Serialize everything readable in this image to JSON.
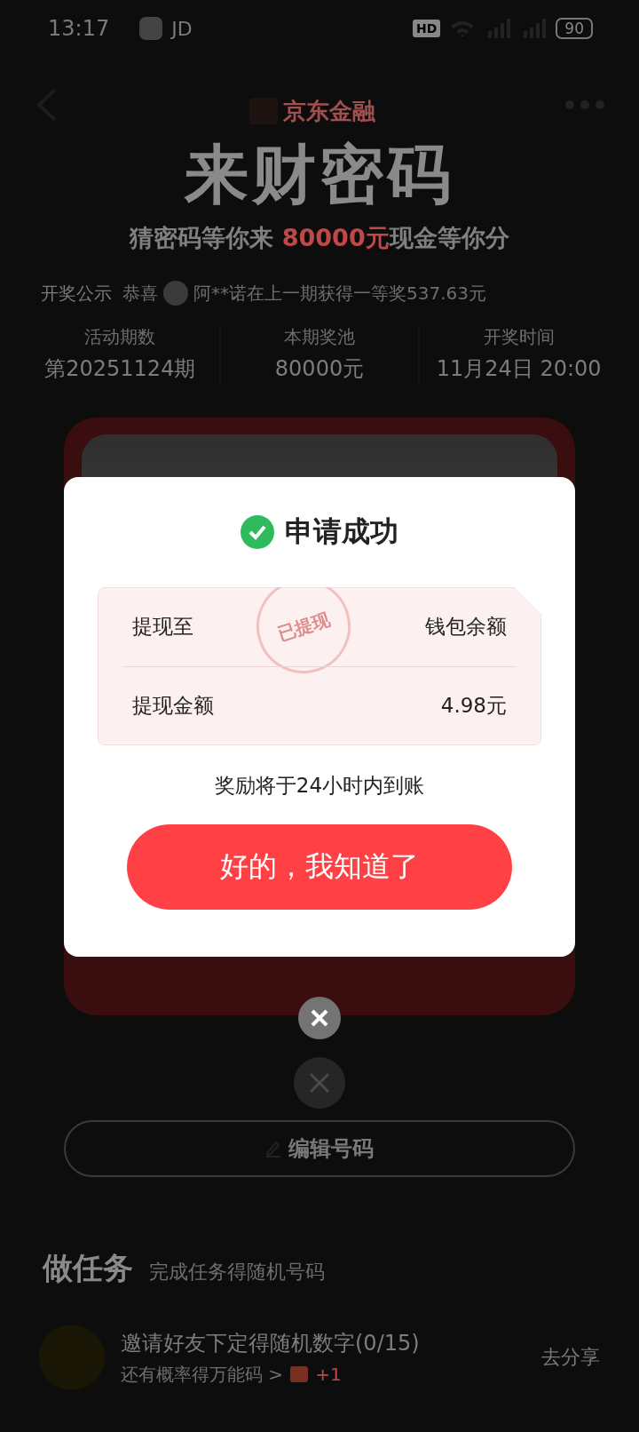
{
  "status_bar": {
    "time": "13:17",
    "app_badge": "JD",
    "hd_badge": "HD",
    "battery": "90"
  },
  "header": {
    "brand": "京东金融",
    "title": "来财密码",
    "subtitle": [
      {
        "text": "猜密码等你来 ",
        "highlight": false
      },
      {
        "text": "80000元",
        "highlight": true
      },
      {
        "text": "现金等你分",
        "highlight": false
      }
    ]
  },
  "announcement": {
    "label": "开奖公示",
    "message_before": "恭喜",
    "message_after": "阿**诺在上一期获得一等奖537.63元"
  },
  "stats": [
    {
      "label": "活动期数",
      "value": "第20251124期"
    },
    {
      "label": "本期奖池",
      "value": "80000元"
    },
    {
      "label": "开奖时间",
      "value": "11月24日 20:00"
    }
  ],
  "dialog": {
    "title": "申请成功",
    "stamp": "已提现",
    "rows": [
      {
        "label": "提现至",
        "value": "钱包余额"
      },
      {
        "label": "提现金额",
        "value": "4.98元"
      }
    ],
    "note": "奖励将于24小时内到账",
    "confirm_button": "好的，我知道了"
  },
  "edit_button": "编辑号码",
  "tasks_section": {
    "title": "做任务",
    "subtitle": "完成任务得随机号码",
    "tasks": [
      {
        "title": "邀请好友下定得随机数字(0/15)",
        "hint": "还有概率得万能码 >",
        "reward": "+1",
        "action": "去分享"
      }
    ]
  }
}
